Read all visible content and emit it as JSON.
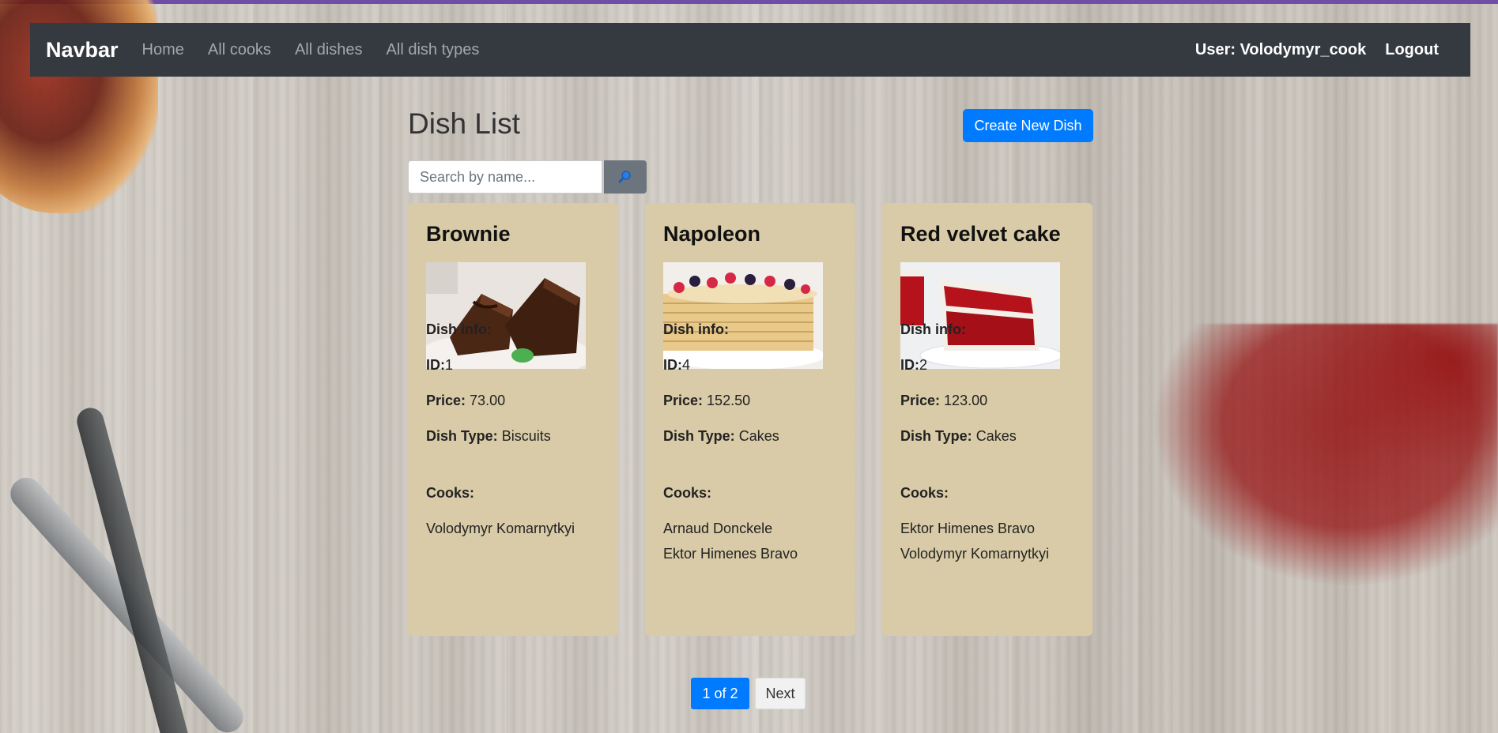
{
  "navbar": {
    "brand": "Navbar",
    "links": [
      "Home",
      "All cooks",
      "All dishes",
      "All dish types"
    ],
    "user": "User: Volodymyr_cook",
    "logout": "Logout"
  },
  "main": {
    "title": "Dish List",
    "create_button": "Create New Dish",
    "search_placeholder": "Search by name..."
  },
  "labels": {
    "dish_info": "Dish info:",
    "id": "ID:",
    "price": "Price:",
    "dish_type": "Dish Type:",
    "cooks": "Cooks:"
  },
  "dishes": [
    {
      "name": "Brownie",
      "id": "1",
      "price": "73.00",
      "dish_type": "Biscuits",
      "cooks": [
        "Volodymyr Komarnytkyi"
      ]
    },
    {
      "name": "Napoleon",
      "id": "4",
      "price": "152.50",
      "dish_type": "Cakes",
      "cooks": [
        "Arnaud Donckele",
        "Ektor Himenes Bravo"
      ]
    },
    {
      "name": "Red velvet cake",
      "id": "2",
      "price": "123.00",
      "dish_type": "Cakes",
      "cooks": [
        "Ektor Himenes Bravo",
        "Volodymyr Komarnytkyi"
      ]
    }
  ],
  "pagination": {
    "current": "1 of 2",
    "next": "Next"
  },
  "colors": {
    "navbar_bg": "#343a40",
    "primary": "#007bff",
    "card_bg": "#d9cba7",
    "secondary": "#6c757d"
  }
}
